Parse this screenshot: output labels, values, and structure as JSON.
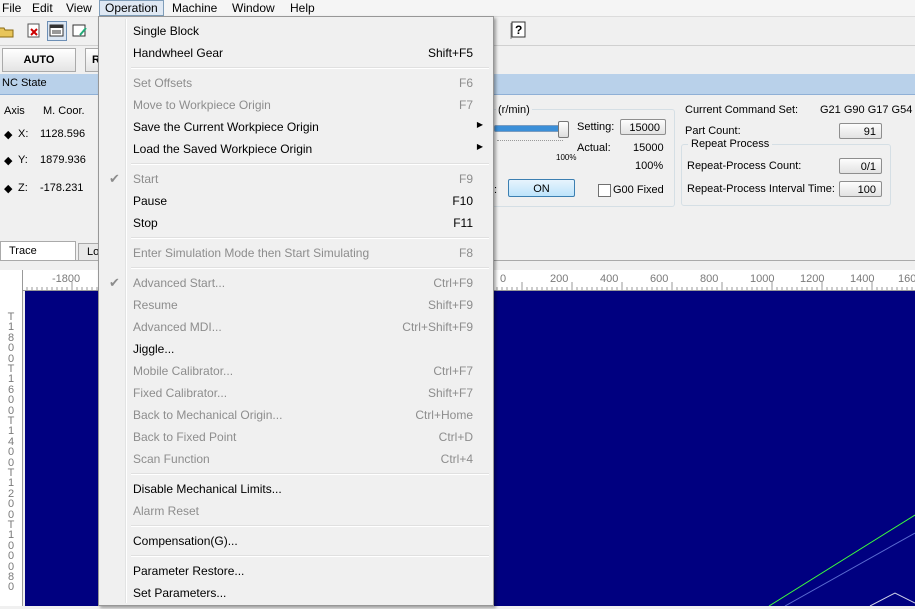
{
  "menubar": {
    "items": [
      "File",
      "Edit",
      "View",
      "Operation",
      "Machine",
      "Window",
      "Help"
    ]
  },
  "mode_tabs": {
    "auto": "AUTO",
    "second": "R"
  },
  "nc_state": {
    "title": "NC State"
  },
  "axes": {
    "header_axis": "Axis",
    "header_coord": "M. Coor.",
    "rows": [
      {
        "label": "X:",
        "value": "1128.596"
      },
      {
        "label": "Y:",
        "value": "1879.936"
      },
      {
        "label": "Z:",
        "value": "-178.231"
      }
    ]
  },
  "spindle": {
    "unit_label": "(r/min)",
    "setting_label": "Setting:",
    "setting_value": "15000",
    "actual_label": "Actual:",
    "actual_value": "15000",
    "override_small": "100%",
    "override_percent": "100%",
    "on_button": "ON",
    "g00_fixed_label": "G00 Fixed",
    "colon": ":"
  },
  "status": {
    "current_command_label": "Current Command Set:",
    "current_command_value": "G21 G90 G17 G54",
    "part_count_label": "Part Count:",
    "part_count_value": "91",
    "repeat_group_title": "Repeat Process",
    "repeat_count_label": "Repeat-Process Count:",
    "repeat_count_value": "0/1",
    "repeat_interval_label": "Repeat-Process Interval Time:",
    "repeat_interval_value": "100"
  },
  "view_tabs": {
    "trace": "Trace",
    "second_partial": "Lo"
  },
  "hruler_ticks_left": [
    "-1800"
  ],
  "hruler_ticks_right": [
    "0",
    "200",
    "400",
    "600",
    "800",
    "1000",
    "1200",
    "1400",
    "160"
  ],
  "vruler_digits": [
    "T",
    "1",
    "8",
    "0",
    "0",
    "T",
    "1",
    "6",
    "0",
    "0",
    "T",
    "1",
    "4",
    "0",
    "0",
    "T",
    "1",
    "2",
    "0",
    "0",
    "T",
    "1",
    "0",
    "0",
    "0",
    "8",
    "0"
  ],
  "operation_menu": [
    {
      "label": "Single Block",
      "shortcut": "",
      "enabled": true
    },
    {
      "label": "Handwheel Gear",
      "shortcut": "Shift+F5",
      "enabled": true
    },
    {
      "sep": true
    },
    {
      "label": "Set Offsets",
      "shortcut": "F6",
      "enabled": false
    },
    {
      "label": "Move to Workpiece Origin",
      "shortcut": "F7",
      "enabled": false
    },
    {
      "label": "Save the Current Workpiece Origin",
      "shortcut": "",
      "enabled": true,
      "submenu": true
    },
    {
      "label": "Load the Saved Workpiece Origin",
      "shortcut": "",
      "enabled": true,
      "submenu": true
    },
    {
      "sep": true
    },
    {
      "label": "Start",
      "shortcut": "F9",
      "enabled": false,
      "checked": true
    },
    {
      "label": "Pause",
      "shortcut": "F10",
      "enabled": true
    },
    {
      "label": "Stop",
      "shortcut": "F11",
      "enabled": true
    },
    {
      "sep": true
    },
    {
      "label": "Enter Simulation Mode then Start Simulating",
      "shortcut": "F8",
      "enabled": false
    },
    {
      "sep": true
    },
    {
      "label": "Advanced Start...",
      "shortcut": "Ctrl+F9",
      "enabled": false,
      "checked": true
    },
    {
      "label": "Resume",
      "shortcut": "Shift+F9",
      "enabled": false
    },
    {
      "label": "Advanced MDI...",
      "shortcut": "Ctrl+Shift+F9",
      "enabled": false
    },
    {
      "label": "Jiggle...",
      "shortcut": "",
      "enabled": true
    },
    {
      "label": "Mobile Calibrator...",
      "shortcut": "Ctrl+F7",
      "enabled": false
    },
    {
      "label": "Fixed Calibrator...",
      "shortcut": "Shift+F7",
      "enabled": false
    },
    {
      "label": "Back to Mechanical Origin...",
      "shortcut": "Ctrl+Home",
      "enabled": false
    },
    {
      "label": "Back to Fixed Point",
      "shortcut": "Ctrl+D",
      "enabled": false
    },
    {
      "label": "Scan Function",
      "shortcut": "Ctrl+4",
      "enabled": false
    },
    {
      "sep": true
    },
    {
      "label": "Disable Mechanical Limits...",
      "shortcut": "",
      "enabled": true
    },
    {
      "label": "Alarm Reset",
      "shortcut": "",
      "enabled": false
    },
    {
      "sep": true
    },
    {
      "label": "Compensation(G)...",
      "shortcut": "",
      "enabled": true
    },
    {
      "sep": true
    },
    {
      "label": "Parameter Restore...",
      "shortcut": "",
      "enabled": true
    },
    {
      "label": "Set Parameters...",
      "shortcut": "",
      "enabled": true
    }
  ],
  "colors": {
    "canvas_bg": "#000080",
    "trace_line": "#3cff3c",
    "nc_state_header": "#b9d1ea"
  }
}
